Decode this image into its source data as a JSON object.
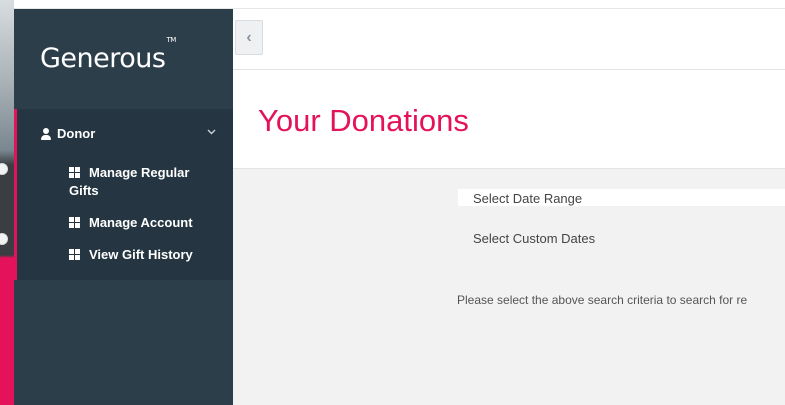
{
  "brand": {
    "name": "Generous",
    "trademark": "TM"
  },
  "sidebar": {
    "section": {
      "label": "Donor",
      "icon": "user-icon",
      "expand_icon": "chevron-down-icon"
    },
    "items": [
      {
        "label": "Manage Regular Gifts",
        "icon": "grid-icon"
      },
      {
        "label": "Manage Account",
        "icon": "grid-icon"
      },
      {
        "label": "View Gift History",
        "icon": "grid-icon"
      }
    ]
  },
  "header": {
    "collapse_icon": "chevron-left-icon",
    "collapse_glyph": "‹"
  },
  "page": {
    "title": "Your Donations"
  },
  "filters": {
    "date_range_placeholder": "Select Date Range",
    "custom_dates_label": "Select Custom Dates"
  },
  "message": "Please select the above search criteria to search for re",
  "colors": {
    "accent": "#e3125a",
    "sidebar": "#2c3e4a",
    "sidebar_active": "#253642"
  }
}
